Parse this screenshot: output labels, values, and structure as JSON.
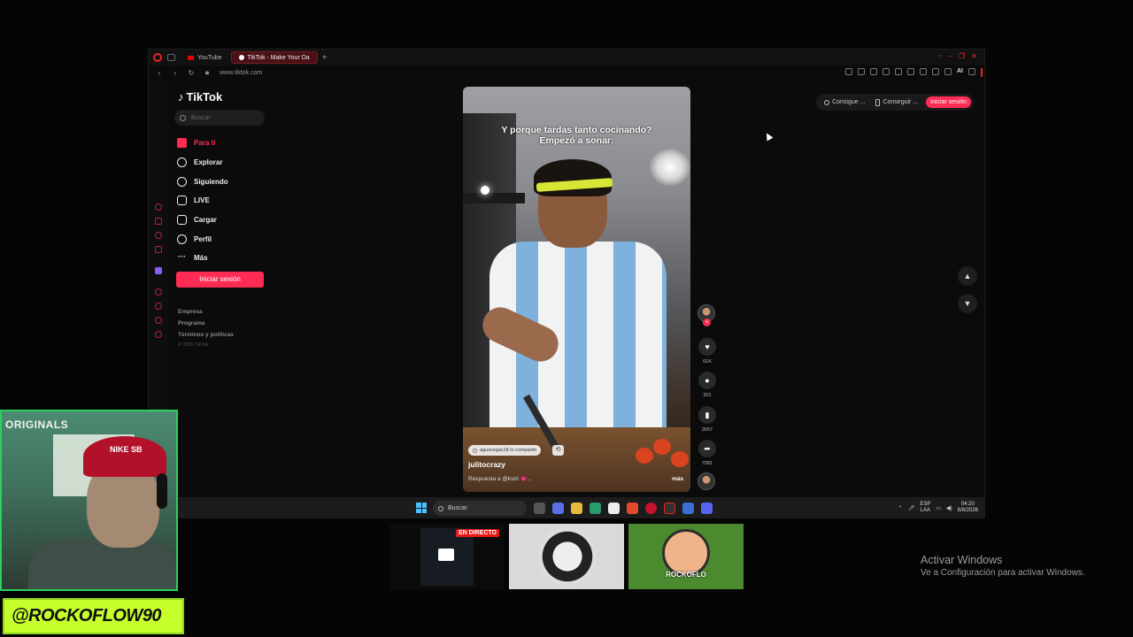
{
  "browser": {
    "tabs": [
      {
        "label": "YouTube",
        "active": false
      },
      {
        "label": "TikTok - Make Your Da",
        "active": true
      }
    ],
    "url": "www.tiktok.com",
    "ai_label": "AI"
  },
  "tiktok": {
    "logo": "TikTok",
    "search_placeholder": "Buscar",
    "menu": [
      {
        "label": "Para ti",
        "icon": "home-icon",
        "active": true
      },
      {
        "label": "Explorar",
        "icon": "compass-icon",
        "active": false
      },
      {
        "label": "Siguiendo",
        "icon": "user-follow-icon",
        "active": false
      },
      {
        "label": "LIVE",
        "icon": "live-icon",
        "active": false
      },
      {
        "label": "Cargar",
        "icon": "upload-icon",
        "active": false
      },
      {
        "label": "Perfil",
        "icon": "profile-icon",
        "active": false
      },
      {
        "label": "Más",
        "icon": "more-icon",
        "active": false
      }
    ],
    "login_button": "Iniciar sesión",
    "footer": [
      "Empresa",
      "Programa",
      "Términos y políticas"
    ],
    "copyright": "© 2026 TikTok",
    "top_pills": [
      "Consigue ...",
      "Conseguir ..."
    ],
    "top_login": "Iniciar sesión"
  },
  "video": {
    "caption_line1": "Y porque tardas tanto cocinando?",
    "caption_line2": "Empezó a sonar:",
    "shared_by": "agusvegas18 lo compartió",
    "username": "julitocrazy",
    "reply": "Respuesta a @kstri 💗...",
    "more": "más",
    "likes": "61K",
    "comments": "301",
    "saves": "2657",
    "shares": "7081"
  },
  "taskbar": {
    "search": "Buscar",
    "lang_line1": "ESP",
    "lang_line2": "LAA",
    "time": "04:20",
    "date": "6/8/2026"
  },
  "overlay": {
    "webcam_text": "ORIGINALS",
    "cap_logo": "NIKE SB",
    "handle": "@ROCKOFLOW90",
    "live_badge": "EN DIRECTO",
    "thumb3_tag": "ROCKOFLO"
  },
  "watermark": {
    "line1": "Activar Windows",
    "line2": "Ve a Configuración para activar Windows."
  }
}
